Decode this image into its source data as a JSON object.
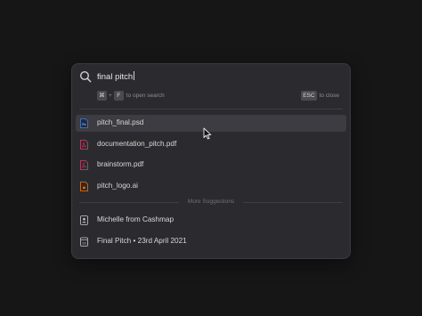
{
  "search": {
    "query": "final pitch",
    "open_key_1": "⌘",
    "plus": "+",
    "open_key_2": "F",
    "open_hint": "to open search",
    "close_key": "ESC",
    "close_hint": "to close"
  },
  "results": [
    {
      "label": "pitch_final.psd",
      "icon": "psd-file-icon",
      "icon_text": "Ps",
      "color": "#4a7bd0",
      "selected": true
    },
    {
      "label": "documentation_pitch.pdf",
      "icon": "pdf-file-icon",
      "color": "#d0436b",
      "selected": false
    },
    {
      "label": "brainstorm.pdf",
      "icon": "pdf-file-icon",
      "color": "#d0436b",
      "selected": false
    },
    {
      "label": "pitch_logo.ai",
      "icon": "ai-file-icon",
      "icon_text": "Ai",
      "color": "#e07b2a",
      "selected": false
    }
  ],
  "suggestions_header": "More Suggestions",
  "suggestions": [
    {
      "label": "Michelle from Cashmap",
      "icon": "contact-card-icon"
    },
    {
      "label": "Final Pitch • 23rd April 2021",
      "icon": "calendar-icon",
      "icon_text": "23"
    }
  ],
  "colors": {
    "background": "#161616",
    "panel": "#2b2b2f",
    "selected_row": "#3c3c42",
    "text": "#d8d8da",
    "muted": "#8e8e93"
  }
}
